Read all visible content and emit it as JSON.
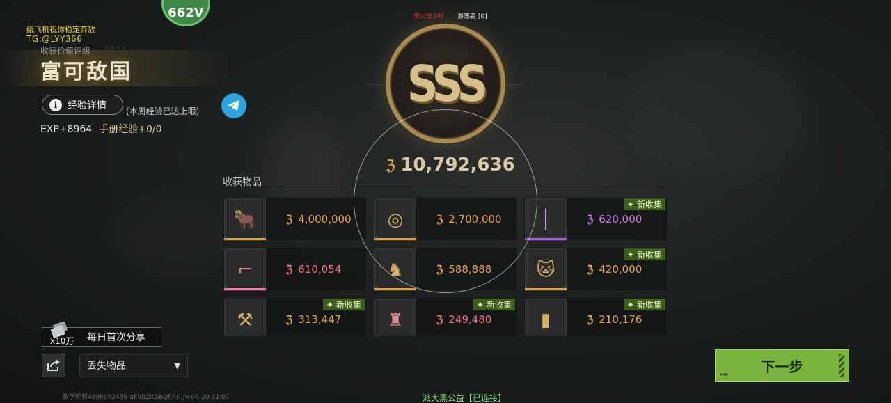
{
  "header": {
    "badge_text": "662V",
    "promo_line1": "纸飞机祝你稳定奔放",
    "promo_line2": "TG:@LYY366",
    "rating_label": "收获价值评级",
    "rating_title": "富可敌国",
    "exp_button_label": "经验详情",
    "week_cap_note": "(本周经验已达上限)",
    "exp_value": "EXP+8964",
    "manual_exp": "手册经验+0/0"
  },
  "players": {
    "tag_a": "季火鬼 [0]",
    "tag_b": "游荡者 [0]"
  },
  "summary": {
    "grade": "SSS",
    "total_value": "10,792,636",
    "currency_icon": "hafu-coin-icon"
  },
  "loot": {
    "title": "收获物品",
    "items": [
      {
        "name": "bull-statue",
        "price": "4,000,000",
        "rarity": "gold",
        "is_new": false,
        "new_label": ""
      },
      {
        "name": "pearl-disc",
        "price": "2,700,000",
        "rarity": "gold",
        "is_new": false,
        "new_label": ""
      },
      {
        "name": "thin-rod",
        "price": "620,000",
        "rarity": "purple",
        "is_new": true,
        "new_label": "新收集"
      },
      {
        "name": "rifle",
        "price": "610,054",
        "rarity": "pink",
        "is_new": false,
        "new_label": ""
      },
      {
        "name": "golden-figure",
        "price": "588,888",
        "rarity": "gold",
        "is_new": false,
        "new_label": ""
      },
      {
        "name": "lucky-cat",
        "price": "420,000",
        "rarity": "gold",
        "is_new": true,
        "new_label": "新收集"
      },
      {
        "name": "long-weapon",
        "price": "313,447",
        "rarity": "gold",
        "is_new": true,
        "new_label": "新收集"
      },
      {
        "name": "armor-suit",
        "price": "249,480",
        "rarity": "pink",
        "is_new": true,
        "new_label": "新收集"
      },
      {
        "name": "bottle",
        "price": "210,176",
        "rarity": "gold",
        "is_new": true,
        "new_label": "新收集"
      }
    ]
  },
  "footer": {
    "share_count": "x10万",
    "share_label": "每日首次分享",
    "lost_items_label": "丢失物品",
    "id_text": "数字昵称4896062456-aFVbZiLSbQfjR(I)JV-06-20-21:07",
    "status_text": "派大黑公益【已连接】",
    "next_label": "下一步"
  },
  "colors": {
    "gold": "#e8a24a",
    "pink": "#f07080",
    "purple": "#d07ae8",
    "next_green": "#7ab33d",
    "telegram_blue": "#2aa3e0"
  }
}
